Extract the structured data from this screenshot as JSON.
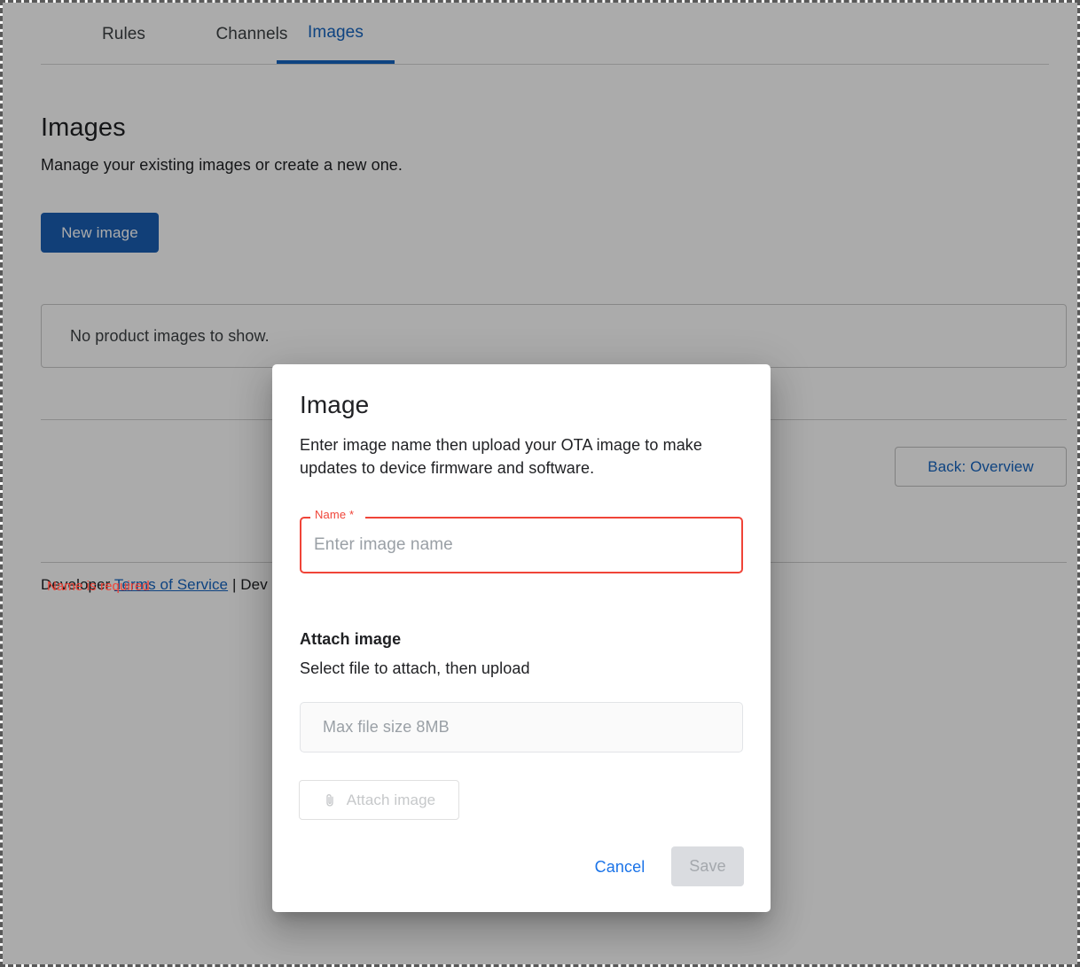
{
  "tabs": [
    {
      "label": "Rules",
      "active": false
    },
    {
      "label": "Channels",
      "active": false
    },
    {
      "label": "Images",
      "active": true
    }
  ],
  "page": {
    "title": "Images",
    "subtitle": "Manage your existing images or create a new one.",
    "new_image_button": "New image",
    "empty_state": "No product images to show.",
    "back_button": "Back: Overview"
  },
  "footer": {
    "prefix": "Developer",
    "terms_link": "Terms of Service",
    "separator": "|",
    "suffix": "Dev"
  },
  "dialog": {
    "title": "Image",
    "description": "Enter image name then upload your OTA image to make updates to device firmware and software.",
    "name_field": {
      "label": "Name *",
      "value": "",
      "placeholder": "Enter image name",
      "error": "Name is required"
    },
    "attach_section": {
      "title": "Attach image",
      "subtitle": "Select file to attach, then upload",
      "file_hint": "Max file size 8MB",
      "attach_button": "Attach image",
      "attach_icon": "paperclip-icon"
    },
    "actions": {
      "cancel": "Cancel",
      "save": "Save"
    }
  },
  "colors": {
    "accent_blue": "#1565c0",
    "primary_button": "#1a5fb4",
    "link_blue": "#1a73e8",
    "error_red": "#f04438",
    "disabled_gray": "#dadce0",
    "scrim": "rgba(0,0,0,0.33)"
  }
}
